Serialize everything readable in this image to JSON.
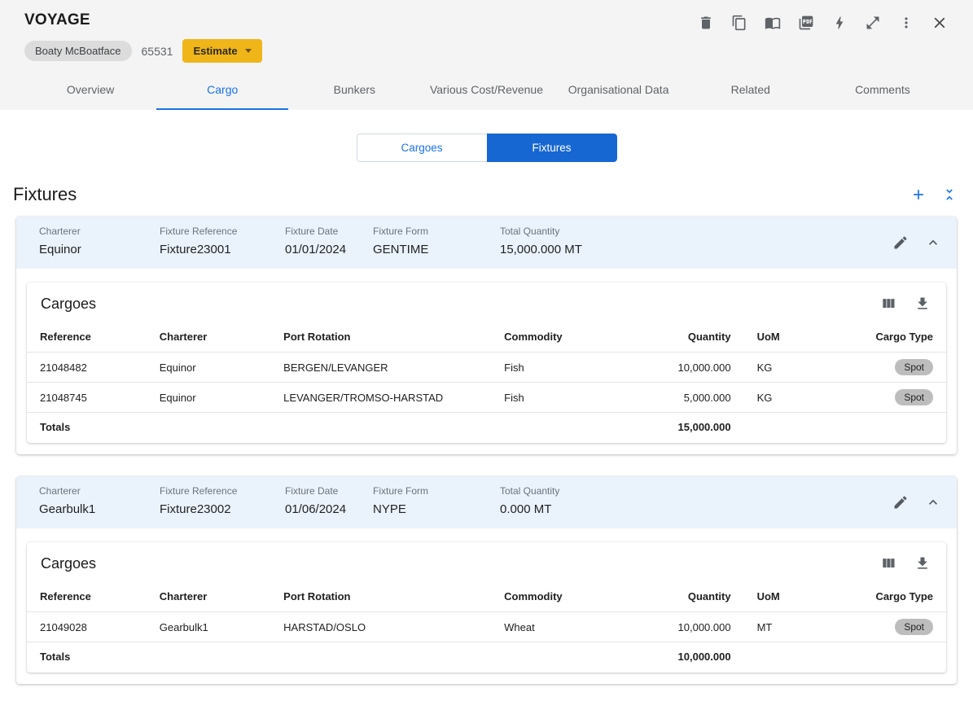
{
  "header": {
    "title": "VOYAGE",
    "vessel": "Boaty McBoatface",
    "voyage_number": "65531",
    "estimate_label": "Estimate"
  },
  "tabs": {
    "items": [
      "Overview",
      "Cargo",
      "Bunkers",
      "Various Cost/Revenue",
      "Organisational Data",
      "Related",
      "Comments"
    ],
    "active": "Cargo"
  },
  "view_toggle": {
    "cargoes_label": "Cargoes",
    "fixtures_label": "Fixtures",
    "active": "Fixtures"
  },
  "section_title": "Fixtures",
  "field_labels": {
    "charterer": "Charterer",
    "fixture_reference": "Fixture Reference",
    "fixture_date": "Fixture Date",
    "fixture_form": "Fixture Form",
    "total_quantity": "Total Quantity"
  },
  "cargo_table": {
    "title": "Cargoes",
    "columns": [
      "Reference",
      "Charterer",
      "Port Rotation",
      "Commodity",
      "Quantity",
      "UoM",
      "Cargo Type"
    ],
    "totals_label": "Totals"
  },
  "fixtures": [
    {
      "charterer": "Equinor",
      "fixture_reference": "Fixture23001",
      "fixture_date": "01/01/2024",
      "fixture_form": "GENTIME",
      "total_quantity": "15,000.000 MT",
      "rows": [
        {
          "reference": "21048482",
          "charterer": "Equinor",
          "port_rotation": "BERGEN/LEVANGER",
          "commodity": "Fish",
          "quantity": "10,000.000",
          "uom": "KG",
          "cargo_type": "Spot"
        },
        {
          "reference": "21048745",
          "charterer": "Equinor",
          "port_rotation": "LEVANGER/TROMSO-HARSTAD",
          "commodity": "Fish",
          "quantity": "5,000.000",
          "uom": "KG",
          "cargo_type": "Spot"
        }
      ],
      "totals_quantity": "15,000.000"
    },
    {
      "charterer": "Gearbulk1",
      "fixture_reference": "Fixture23002",
      "fixture_date": "01/06/2024",
      "fixture_form": "NYPE",
      "total_quantity": "0.000 MT",
      "rows": [
        {
          "reference": "21049028",
          "charterer": "Gearbulk1",
          "port_rotation": "HARSTAD/OSLO",
          "commodity": "Wheat",
          "quantity": "10,000.000",
          "uom": "MT",
          "cargo_type": "Spot"
        }
      ],
      "totals_quantity": "10,000.000"
    }
  ],
  "colors": {
    "accent_blue": "#1a73e8",
    "toggle_active_blue": "#1767d2",
    "estimate_amber": "#efb519",
    "card_header_bg": "#eaf2fb",
    "chip_gray": "#bdbdbd",
    "header_gray": "#f4f4f4"
  }
}
